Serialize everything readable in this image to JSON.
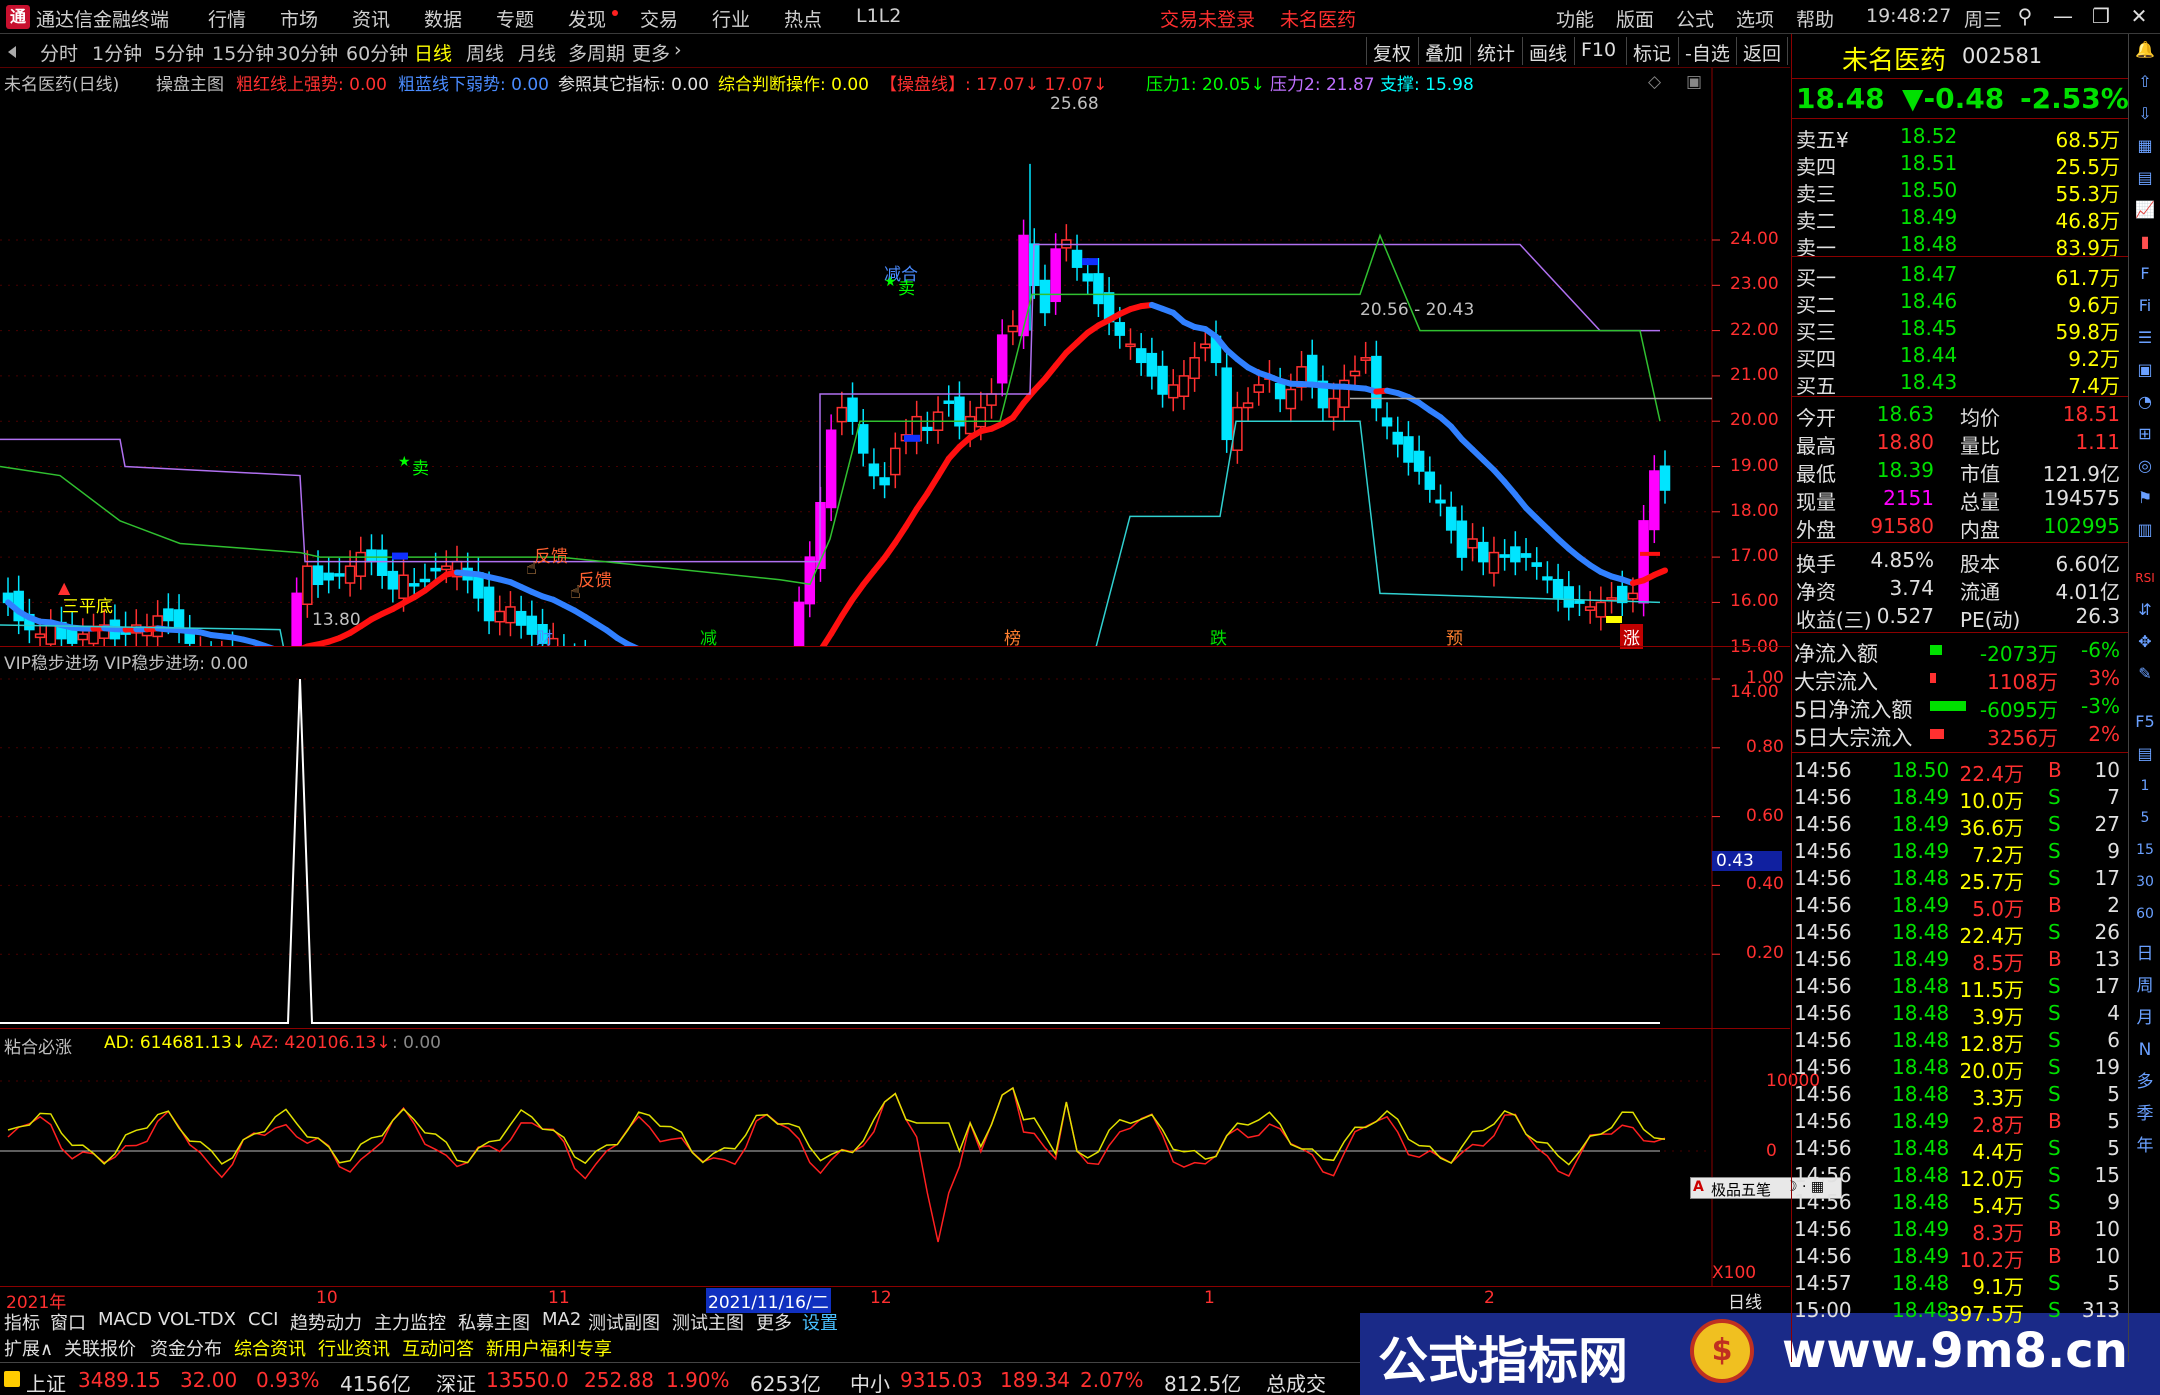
{
  "titlebar": {
    "app_title": "通达信金融终端",
    "menus": [
      "行情",
      "市场",
      "资讯",
      "数据",
      "专题",
      "发现",
      "交易",
      "行业",
      "热点",
      "L1L2"
    ],
    "login": "交易未登录",
    "stock_title": "未名医药",
    "right_menus": [
      "功能",
      "版面",
      "公式",
      "选项",
      "帮助"
    ],
    "time": "19:48:27",
    "weekday": "周三"
  },
  "periods": [
    "分时",
    "1分钟",
    "5分钟",
    "15分钟",
    "30分钟",
    "60分钟",
    "日线",
    "周线",
    "月线",
    "多周期",
    "更多"
  ],
  "selected_period": "日线",
  "chart_tools": [
    "复权",
    "叠加",
    "统计",
    "画线",
    "F10",
    "标记",
    "-自选",
    "返回"
  ],
  "main_chart": {
    "legend": [
      {
        "text": "未名医药(日线)",
        "color": "#c0c0c0"
      },
      {
        "text": "操盘主图",
        "color": "#c0c0c0"
      },
      {
        "text": "粗红线上强势: 0.00",
        "color": "#ff3030"
      },
      {
        "text": "粗蓝线下弱势: 0.00",
        "color": "#4a8cff"
      },
      {
        "text": "参照其它指标: 0.00",
        "color": "#e0e0e0"
      },
      {
        "text": "综合判断操作: 0.00",
        "color": "#ffff00"
      },
      {
        "text": "【操盘线】: 17.07↓ 17.07↓",
        "color": "#ff3030"
      },
      {
        "text": "压力1: 20.05↓",
        "color": "#00ff00"
      },
      {
        "text": "压力2: 21.87",
        "color": "#c070ff"
      },
      {
        "text": "支撑: 15.98",
        "color": "#00ffff"
      }
    ],
    "y_ticks": [
      "24.00",
      "23.00",
      "22.00",
      "21.00",
      "20.00",
      "19.00",
      "18.00",
      "17.00",
      "16.00",
      "15.00",
      "14.00"
    ],
    "annotations": {
      "high": "25.68",
      "low": "13.80",
      "range": "20.56 - 20.43",
      "sanpingdi": "三平底",
      "sell1": "卖",
      "sell2": "卖",
      "hehe": "减合",
      "fankui1": "反馈",
      "fankui2": "反馈"
    },
    "bottom_labels": [
      "财",
      "减",
      "榜",
      "跌",
      "预",
      "涨"
    ]
  },
  "sub1": {
    "legend": "VIP稳步进场 VIP稳步进场: 0.00",
    "y_ticks": [
      "1.00",
      "0.80",
      "0.60",
      "0.40",
      "0.20"
    ],
    "cursor_value": "0.43"
  },
  "sub2": {
    "legend_name": "粘合必涨",
    "ad": "AD: 614681.13↓",
    "az": "AZ: 420106.13↓",
    "extra": ": 0.00",
    "y_ticks": [
      "10000",
      "0"
    ],
    "x100": "X100",
    "widget": "极品五笔"
  },
  "date_axis": {
    "labels": [
      "2021年",
      "10",
      "11",
      "2021/11/16/二",
      "12",
      "1",
      "2"
    ],
    "period": "日线"
  },
  "tabs_row1": [
    "指标",
    "窗口",
    "MACD",
    "VOL-TDX",
    "CCI",
    "趋势动力",
    "主力监控",
    "私募主图",
    "MA2",
    "测试副图",
    "测试主图",
    "更多",
    "设置"
  ],
  "tabs_row2": [
    "扩展∧",
    "关联报价",
    "资金分布",
    "综合资讯",
    "行业资讯",
    "互动问答",
    "新用户福利专享"
  ],
  "watermark": {
    "text": "公式指标网",
    "url": "www.9m8.cn"
  },
  "status": {
    "sh_name": "上证",
    "sh_val": "3489.15",
    "sh_chg": "32.00",
    "sh_pct": "0.93%",
    "sh_amt": "4156亿",
    "sz_name": "深证",
    "sz_val": "13550.0",
    "sz_chg": "252.88",
    "sz_pct": "1.90%",
    "sz_amt": "6253亿",
    "zx_name": "中小",
    "zx_val": "9315.03",
    "zx_chg": "189.34",
    "zx_pct": "2.07%",
    "zx_amt": "812.5亿",
    "total": "总成交"
  },
  "quote": {
    "name": "未名医药",
    "code": "002581",
    "price": "18.48",
    "change": "▼-0.48",
    "pct": "-2.53%",
    "asks": [
      {
        "label": "卖五",
        "sym": "¥",
        "price": "18.52",
        "vol": "68.5万"
      },
      {
        "label": "卖四",
        "price": "18.51",
        "vol": "25.5万"
      },
      {
        "label": "卖三",
        "price": "18.50",
        "vol": "55.3万"
      },
      {
        "label": "卖二",
        "price": "18.49",
        "vol": "46.8万"
      },
      {
        "label": "卖一",
        "price": "18.48",
        "vol": "83.9万"
      }
    ],
    "bids": [
      {
        "label": "买一",
        "price": "18.47",
        "vol": "61.7万"
      },
      {
        "label": "买二",
        "price": "18.46",
        "vol": "9.6万"
      },
      {
        "label": "买三",
        "price": "18.45",
        "vol": "59.8万"
      },
      {
        "label": "买四",
        "price": "18.44",
        "vol": "9.2万"
      },
      {
        "label": "买五",
        "price": "18.43",
        "vol": "7.4万"
      }
    ],
    "stats": [
      {
        "l1": "今开",
        "v1": "18.63",
        "l2": "均价",
        "v2": "18.51"
      },
      {
        "l1": "最高",
        "v1": "18.80",
        "l2": "量比",
        "v2": "1.11"
      },
      {
        "l1": "最低",
        "v1": "18.39",
        "l2": "市值",
        "v2": "121.9亿"
      },
      {
        "l1": "现量",
        "v1": "2151",
        "l2": "总量",
        "v2": "194575"
      },
      {
        "l1": "外盘",
        "v1": "91580",
        "l2": "内盘",
        "v2": "102995"
      }
    ],
    "fund": [
      {
        "l1": "换手",
        "v1": "4.85%",
        "l2": "股本",
        "v2": "6.60亿"
      },
      {
        "l1": "净资",
        "v1": "3.74",
        "l2": "流通",
        "v2": "4.01亿"
      },
      {
        "l1": "收益(三)",
        "v1": "0.527",
        "l2": "PE(动)",
        "v2": "26.3"
      }
    ],
    "flows": [
      {
        "label": "净流入额",
        "val": "-2073万",
        "pct": "-6%",
        "color": "#00e000"
      },
      {
        "label": "大宗流入",
        "val": "1108万",
        "pct": "3%",
        "color": "#ff3030"
      },
      {
        "label": "5日净流入额",
        "val": "-6095万",
        "pct": "-3%",
        "color": "#00e000"
      },
      {
        "label": "5日大宗流入",
        "val": "3256万",
        "pct": "2%",
        "color": "#ff3030"
      }
    ],
    "ticks": [
      [
        "14:56",
        "18.50",
        "22.4万",
        "B",
        "10"
      ],
      [
        "14:56",
        "18.49",
        "10.0万",
        "S",
        "7"
      ],
      [
        "14:56",
        "18.49",
        "36.6万",
        "S",
        "27"
      ],
      [
        "14:56",
        "18.49",
        "7.2万",
        "S",
        "9"
      ],
      [
        "14:56",
        "18.48",
        "25.7万",
        "S",
        "17"
      ],
      [
        "14:56",
        "18.49",
        "5.0万",
        "B",
        "2"
      ],
      [
        "14:56",
        "18.48",
        "22.4万",
        "S",
        "26"
      ],
      [
        "14:56",
        "18.49",
        "8.5万",
        "B",
        "13"
      ],
      [
        "14:56",
        "18.48",
        "11.5万",
        "S",
        "17"
      ],
      [
        "14:56",
        "18.48",
        "3.9万",
        "S",
        "4"
      ],
      [
        "14:56",
        "18.48",
        "12.8万",
        "S",
        "6"
      ],
      [
        "14:56",
        "18.48",
        "20.0万",
        "S",
        "19"
      ],
      [
        "14:56",
        "18.48",
        "3.3万",
        "S",
        "5"
      ],
      [
        "14:56",
        "18.49",
        "2.8万",
        "B",
        "5"
      ],
      [
        "14:56",
        "18.48",
        "4.4万",
        "S",
        "5"
      ],
      [
        "14:56",
        "18.48",
        "12.0万",
        "S",
        "15"
      ],
      [
        "14:56",
        "18.48",
        "5.4万",
        "S",
        "9"
      ],
      [
        "14:56",
        "18.49",
        "8.3万",
        "B",
        "10"
      ],
      [
        "14:56",
        "18.49",
        "10.2万",
        "B",
        "10"
      ],
      [
        "14:57",
        "18.48",
        "9.1万",
        "S",
        "5"
      ],
      [
        "15:00",
        "18.48",
        "397.5万",
        "S",
        "313"
      ]
    ]
  },
  "side_tools": [
    "日",
    "周",
    "月",
    "N",
    "多",
    "季",
    "年"
  ],
  "colors": {
    "up": "#ff3030",
    "down": "#00e5ff",
    "hot": "#ff00ff",
    "ma_red": "#ff1010",
    "ma_blue": "#3080ff",
    "panel_border": "#8b0000"
  }
}
